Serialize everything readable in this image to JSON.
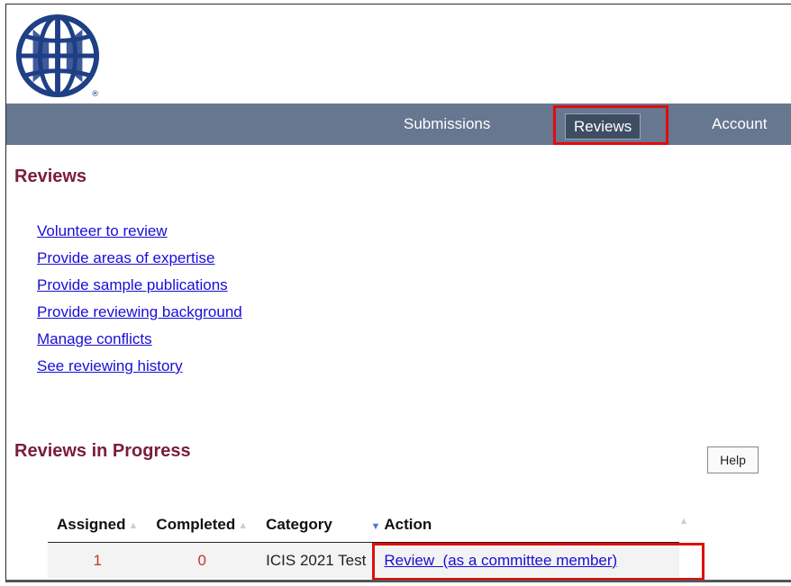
{
  "nav": {
    "items": [
      {
        "label": "Submissions"
      },
      {
        "label": "Reviews"
      },
      {
        "label": "Account"
      }
    ]
  },
  "page": {
    "title": "Reviews"
  },
  "links": [
    {
      "label": "Volunteer to review"
    },
    {
      "label": "Provide areas of expertise"
    },
    {
      "label": "Provide sample publications"
    },
    {
      "label": "Provide reviewing background"
    },
    {
      "label": "Manage conflicts"
    },
    {
      "label": "See reviewing history"
    }
  ],
  "reviews_in_progress": {
    "title": "Reviews in Progress",
    "help_label": "Help",
    "columns": [
      "Assigned",
      "Completed",
      "Category",
      "Action"
    ],
    "rows": [
      {
        "assigned": "1",
        "completed": "0",
        "category": "ICIS 2021 Test",
        "action": "Review  (as a committee member)"
      }
    ]
  },
  "colors": {
    "navbar": "#66778f",
    "heading": "#7a1d3c",
    "link": "#1a0dd8",
    "highlight": "#e00d0d"
  },
  "icons": [
    "globe-logo-icon",
    "sort-icon",
    "sort-desc-icon"
  ]
}
